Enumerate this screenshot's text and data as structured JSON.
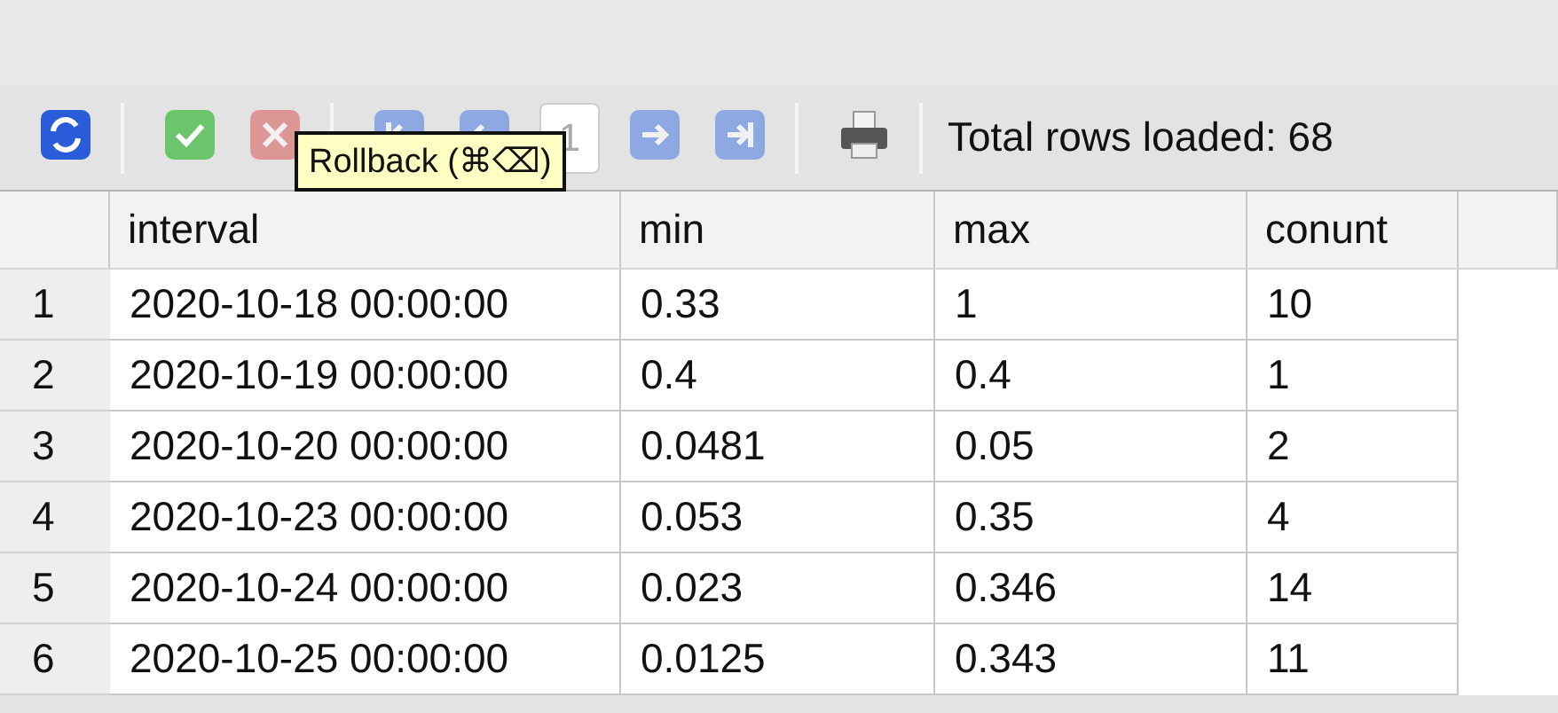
{
  "toolbar": {
    "buttons": [
      {
        "kind": "refresh",
        "disabled": false
      },
      {
        "kind": "commit",
        "disabled": false
      },
      {
        "kind": "rollback",
        "disabled": true
      },
      {
        "kind": "first",
        "disabled": true
      },
      {
        "kind": "prev",
        "disabled": true
      },
      {
        "kind": "page",
        "value": "1"
      },
      {
        "kind": "next",
        "disabled": true
      },
      {
        "kind": "last",
        "disabled": true
      },
      {
        "kind": "print",
        "disabled": false
      }
    ],
    "status": "Total rows loaded: 68"
  },
  "tooltip": "Rollback (⌘⌫)",
  "table": {
    "columns": [
      "interval",
      "min",
      "max",
      "conunt"
    ],
    "rows": [
      {
        "num": "1",
        "cells": [
          "2020-10-18 00:00:00",
          "0.33",
          "1",
          "10"
        ]
      },
      {
        "num": "2",
        "cells": [
          "2020-10-19 00:00:00",
          "0.4",
          "0.4",
          "1"
        ]
      },
      {
        "num": "3",
        "cells": [
          "2020-10-20 00:00:00",
          "0.0481",
          "0.05",
          "2"
        ]
      },
      {
        "num": "4",
        "cells": [
          "2020-10-23 00:00:00",
          "0.053",
          "0.35",
          "4"
        ]
      },
      {
        "num": "5",
        "cells": [
          "2020-10-24 00:00:00",
          "0.023",
          "0.346",
          "14"
        ]
      },
      {
        "num": "6",
        "cells": [
          "2020-10-25 00:00:00",
          "0.0125",
          "0.343",
          "11"
        ]
      }
    ]
  }
}
